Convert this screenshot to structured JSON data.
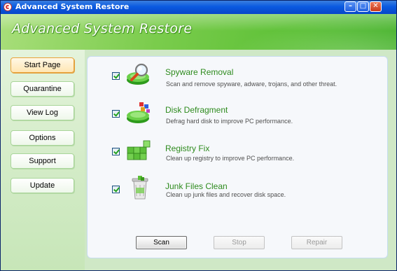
{
  "window": {
    "title": "Advanced System Restore",
    "header_title": "Advanced System Restore"
  },
  "sidebar": {
    "items": [
      {
        "label": "Start Page",
        "active": true
      },
      {
        "label": "Quarantine",
        "active": false
      },
      {
        "label": "View Log",
        "active": false
      },
      {
        "label": "Options",
        "active": false
      },
      {
        "label": "Support",
        "active": false
      },
      {
        "label": "Update",
        "active": false
      }
    ]
  },
  "features": [
    {
      "title": "Spyware Removal",
      "description": "Scan and remove spyware, adware, trojans, and other threat.",
      "checked": true,
      "icon": "magnifier-disk-icon"
    },
    {
      "title": "Disk Defragment",
      "description": "Defrag hard disk to improve PC performance.",
      "checked": true,
      "icon": "disk-blocks-icon"
    },
    {
      "title": "Registry Fix",
      "description": "Clean up registry to improve PC performance.",
      "checked": true,
      "icon": "registry-cubes-icon"
    },
    {
      "title": "Junk Files Clean",
      "description": "Clean up junk files and recover disk space.",
      "checked": true,
      "icon": "trash-bin-icon"
    }
  ],
  "actions": {
    "scan": "Scan",
    "stop": "Stop",
    "repair": "Repair"
  },
  "colors": {
    "title_bar": "#0a5ae0",
    "header_green": "#5cc036",
    "feature_title": "#2e8b1e",
    "active_nav_border": "#e8a33a"
  }
}
